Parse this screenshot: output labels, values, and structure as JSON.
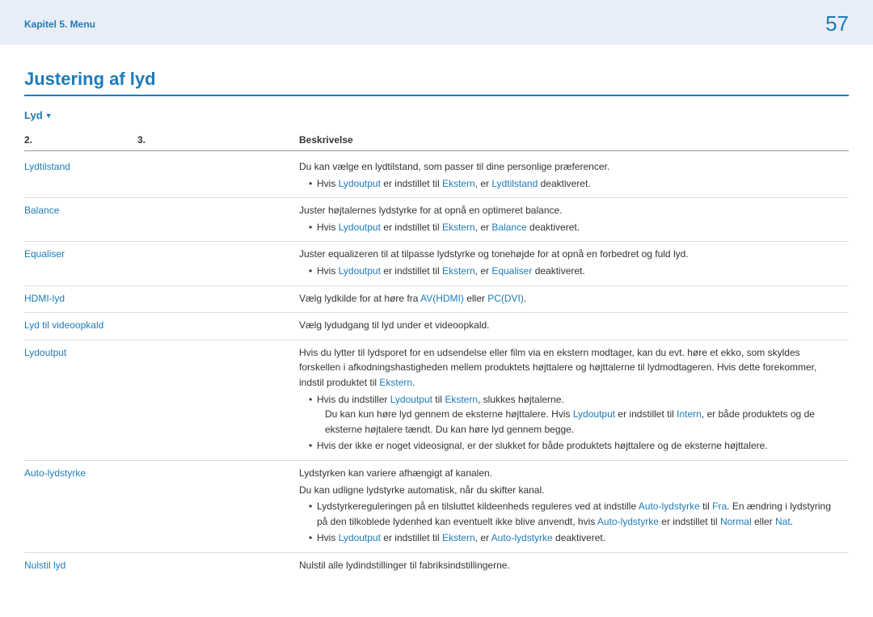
{
  "header": {
    "breadcrumb": "Kapitel 5. Menu",
    "page_number": "57"
  },
  "title": "Justering af lyd",
  "section": "Lyd",
  "table": {
    "headers": {
      "c2": "2.",
      "c3": "3.",
      "desc": "Beskrivelse"
    }
  },
  "rows": {
    "lydtilstand": {
      "label": "Lydtilstand",
      "line1": "Du kan vælge en lydtilstand, som passer til dine personlige præferencer.",
      "b1_pre": "Hvis ",
      "b1_l1": "Lydoutput",
      "b1_mid": " er indstillet til ",
      "b1_l2": "Ekstern",
      "b1_mid2": ", er ",
      "b1_l3": "Lydtilstand",
      "b1_post": " deaktiveret."
    },
    "balance": {
      "label": "Balance",
      "line1": "Juster højtalernes lydstyrke for at opnå en optimeret balance.",
      "b1_pre": "Hvis ",
      "b1_l1": "Lydoutput",
      "b1_mid": " er indstillet til ",
      "b1_l2": "Ekstern",
      "b1_mid2": ", er ",
      "b1_l3": "Balance",
      "b1_post": " deaktiveret."
    },
    "equaliser": {
      "label": "Equaliser",
      "line1": "Juster equalizeren til at tilpasse lydstyrke og tonehøjde for at opnå en forbedret og fuld lyd.",
      "b1_pre": "Hvis ",
      "b1_l1": "Lydoutput",
      "b1_mid": " er indstillet til ",
      "b1_l2": "Ekstern",
      "b1_mid2": ", er ",
      "b1_l3": "Equaliser",
      "b1_post": " deaktiveret."
    },
    "hdmi": {
      "label": "HDMI-lyd",
      "pre": "Vælg lydkilde for at høre fra ",
      "l1": "AV(HDMI)",
      "mid": " eller ",
      "l2": "PC(DVI)",
      "post": "."
    },
    "video": {
      "label": "Lyd til videoopkald",
      "line1": "Vælg lydudgang til lyd under et videoopkald."
    },
    "lydoutput": {
      "label": "Lydoutput",
      "p1a": "Hvis du lytter til lydsporet for en udsendelse eller film via en ekstern modtager, kan du evt. høre et ekko, som skyldes forskellen i afkodningshastigheden mellem produktets højttalere og højttalerne til lydmodtageren. Hvis dette forekommer, indstil produktet til ",
      "p1l": "Ekstern",
      "p1b": ".",
      "b1_pre": "Hvis du indstiller ",
      "b1_l1": "Lydoutput",
      "b1_mid": " til ",
      "b1_l2": "Ekstern",
      "b1_post": ", slukkes højtalerne.",
      "b1_sub_a": "Du kan kun høre lyd gennem de eksterne højttalere. Hvis ",
      "b1_sub_l": "Lydoutput",
      "b1_sub_b": " er indstillet til ",
      "b1_sub_l2": "Intern",
      "b1_sub_c": ", er både produktets og de eksterne højtalere tændt. Du kan høre lyd gennem begge.",
      "b2": "Hvis der ikke er noget videosignal, er der slukket for både produktets højttalere og de eksterne højttalere."
    },
    "auto": {
      "label": "Auto-lydstyrke",
      "p1": "Lydstyrken kan variere afhængigt af kanalen.",
      "p2": "Du kan udligne lydstyrke automatisk, når du skifter kanal.",
      "b1_a": "Lydstyrkereguleringen på en tilsluttet kildeenheds reguleres ved at indstille ",
      "b1_l1": "Auto-lydstyrke",
      "b1_b": " til ",
      "b1_l2": "Fra",
      "b1_c": ". En ændring i lydstyring på den tilkoblede lydenhed kan eventuelt ikke blive anvendt, hvis ",
      "b1_l3": "Auto-lydstyrke",
      "b1_d": " er indstillet til ",
      "b1_l4": "Normal",
      "b1_e": " eller ",
      "b1_l5": "Nat",
      "b1_f": ".",
      "b2_pre": "Hvis ",
      "b2_l1": "Lydoutput",
      "b2_mid": " er indstillet til ",
      "b2_l2": "Ekstern",
      "b2_mid2": ", er ",
      "b2_l3": "Auto-lydstyrke",
      "b2_post": " deaktiveret."
    },
    "nulstil": {
      "label": "Nulstil lyd",
      "line1": "Nulstil alle lydindstillinger til fabriksindstillingerne."
    }
  }
}
